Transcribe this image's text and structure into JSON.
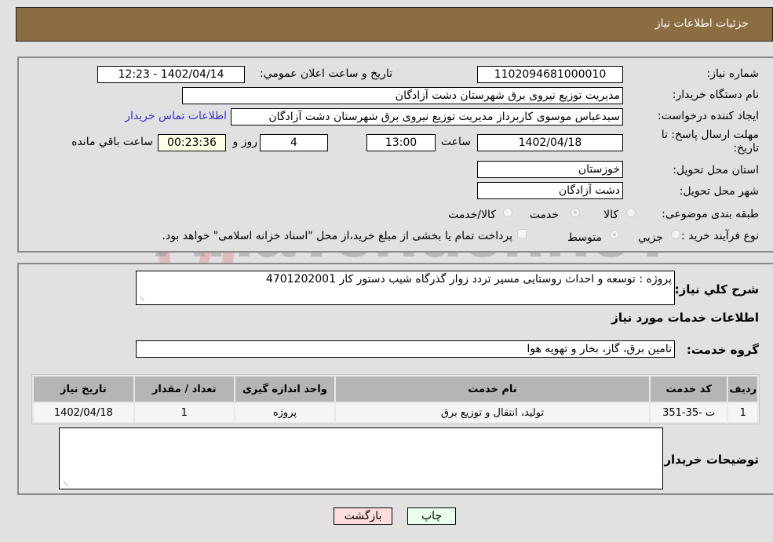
{
  "header": {
    "title": "جزئیات اطلاعات نیاز"
  },
  "details": {
    "need_number_label": "شماره نیاز:",
    "need_number": "1102094681000010",
    "announce_label": "تاریخ و ساعت اعلان عمومي:",
    "announce_value": "1402/04/14 - 12:23",
    "buyer_org_label": "نام دستگاه خریدار:",
    "buyer_org": "مدیریت توزیع نیروی برق شهرستان دشت آزادگان",
    "creator_label": "ایجاد کننده درخواست:",
    "creator": "سیدعباس موسوی کاربرداز مدیریت توزیع نیروی برق شهرستان دشت آزادگان",
    "contact_link": "اطلاعات تماس خریدار",
    "deadline_label": "مهلت ارسال پاسخ: تا تاریخ:",
    "deadline_date": "1402/04/18",
    "time_label": "ساعت",
    "deadline_time": "13:00",
    "days_value": "4",
    "days_label": "روز و",
    "remaining_time": "00:23:36",
    "remaining_label": "ساعت باقي مانده",
    "province_label": "استان محل تحویل:",
    "province": "خوزستان",
    "city_label": "شهر محل تحویل:",
    "city": "دشت آزادگان",
    "category_label": "طبقه بندی موضوعی:",
    "category_options": [
      {
        "label": "کالا",
        "checked": false
      },
      {
        "label": "خدمت",
        "checked": true
      },
      {
        "label": "کالا/خدمت",
        "checked": false
      }
    ],
    "process_label": "نوع فرآیند خرید :",
    "process_options": [
      {
        "label": "جزيي",
        "checked": false
      },
      {
        "label": "متوسط",
        "checked": true
      }
    ],
    "treasury_note": "پرداخت تمام یا بخشی از مبلغ خرید،از محل \"اسناد خزانه اسلامی\" خواهد بود."
  },
  "services": {
    "description_label": "شرح کلي نیاز:",
    "description": "پروژه : توسعه و احداث روستایی مسیر تردد زوار گذرگاه شیب دستور کار 4701202001",
    "section_title": "اطلاعات خدمات مورد نیاز",
    "group_label": "گروه خدمت:",
    "group_value": "تامین برق، گاز، بخار و تهویه هوا",
    "table": {
      "headers": [
        "ردیف",
        "کد خدمت",
        "نام خدمت",
        "واحد اندازه گیری",
        "تعداد / مقدار",
        "تاریخ نیاز"
      ],
      "rows": [
        [
          "1",
          "ت -35-351",
          "تولید، انتقال و توزیع برق",
          "پروژه",
          "1",
          "1402/04/18"
        ]
      ]
    },
    "buyer_notes_label": "توضیحات خریدار:",
    "buyer_notes": ""
  },
  "buttons": {
    "print": "چاپ",
    "back": "بازگشت"
  },
  "watermark": "AriaTender.neT",
  "colors": {
    "header_bg": "#8b6d42",
    "link": "#3333cc",
    "print_bg": "#eaffea",
    "back_bg": "#ffdddd"
  }
}
